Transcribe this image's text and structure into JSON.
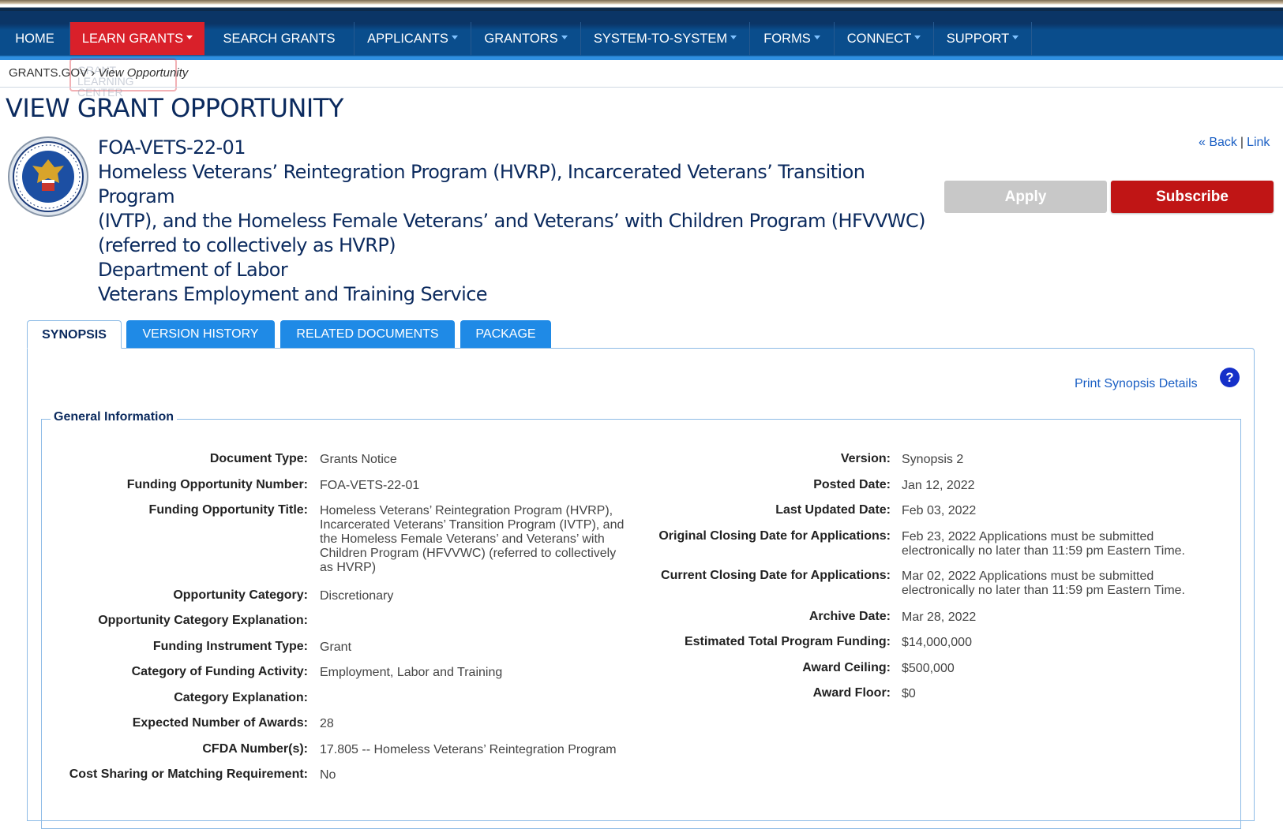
{
  "nav": {
    "items": [
      {
        "label": "HOME"
      },
      {
        "label": "LEARN GRANTS"
      },
      {
        "label": "SEARCH GRANTS"
      },
      {
        "label": "APPLICANTS"
      },
      {
        "label": "GRANTORS"
      },
      {
        "label": "SYSTEM-TO-SYSTEM"
      },
      {
        "label": "FORMS"
      },
      {
        "label": "CONNECT"
      },
      {
        "label": "SUPPORT"
      }
    ],
    "active_color": "#d9202a"
  },
  "breadcrumb": {
    "root": "GRANTS.GOV",
    "separator": "›",
    "current": "View Opportunity",
    "ghost_text": "GRANT LEARNING CENTER"
  },
  "page_title": "VIEW GRANT OPPORTUNITY",
  "opportunity": {
    "number": "FOA-VETS-22-01",
    "title_line1": "Homeless Veterans’ Reintegration Program (HVRP), Incarcerated Veterans’ Transition Program",
    "title_line2": "(IVTP), and the Homeless Female Veterans’ and Veterans’ with Children Program (HFVVWC)",
    "title_line3": "(referred to collectively as HVRP)",
    "agency": "Department of Labor",
    "sub_agency": "Veterans Employment and Training Service",
    "seal_icon": "department-of-labor-seal"
  },
  "actions": {
    "back": "« Back",
    "separator": "|",
    "link": "Link",
    "apply": "Apply",
    "subscribe": "Subscribe"
  },
  "tabs": [
    {
      "label": "SYNOPSIS",
      "active": true
    },
    {
      "label": "VERSION HISTORY",
      "active": false
    },
    {
      "label": "RELATED DOCUMENTS",
      "active": false
    },
    {
      "label": "PACKAGE",
      "active": false
    }
  ],
  "synopsis": {
    "print_link": "Print Synopsis Details",
    "help_icon": "?",
    "section_title": "General Information",
    "left": [
      {
        "label": "Document Type:",
        "value": "Grants Notice"
      },
      {
        "label": "Funding Opportunity Number:",
        "value": "FOA-VETS-22-01"
      },
      {
        "label": "Funding Opportunity Title:",
        "value": "Homeless Veterans’ Reintegration Program (HVRP), Incarcerated Veterans’ Transition Program (IVTP), and the Homeless Female Veterans’ and Veterans’ with Children Program (HFVVWC) (referred to collectively as HVRP)"
      },
      {
        "label": "Opportunity Category:",
        "value": "Discretionary"
      },
      {
        "label": "Opportunity Category Explanation:",
        "value": ""
      },
      {
        "label": "Funding Instrument Type:",
        "value": "Grant"
      },
      {
        "label": "Category of Funding Activity:",
        "value": "Employment, Labor and Training"
      },
      {
        "label": "Category Explanation:",
        "value": ""
      },
      {
        "label": "Expected Number of Awards:",
        "value": "28"
      },
      {
        "label": "CFDA Number(s):",
        "value": "17.805 -- Homeless Veterans’ Reintegration Program"
      },
      {
        "label": "Cost Sharing or Matching Requirement:",
        "value": "No"
      }
    ],
    "right": [
      {
        "label": "Version:",
        "value": "Synopsis 2"
      },
      {
        "label": "Posted Date:",
        "value": "Jan 12, 2022"
      },
      {
        "label": "Last Updated Date:",
        "value": "Feb 03, 2022"
      },
      {
        "label": "Original Closing Date for Applications:",
        "value": "Feb 23, 2022  Applications must be submitted electronically no later than 11:59 pm Eastern Time."
      },
      {
        "label": "Current Closing Date for Applications:",
        "value": "Mar 02, 2022  Applications must be submitted electronically no later than 11:59 pm Eastern Time."
      },
      {
        "label": "Archive Date:",
        "value": "Mar 28, 2022"
      },
      {
        "label": "Estimated Total Program Funding:",
        "value": "$14,000,000"
      },
      {
        "label": "Award Ceiling:",
        "value": "$500,000"
      },
      {
        "label": "Award Floor:",
        "value": "$0"
      }
    ]
  }
}
